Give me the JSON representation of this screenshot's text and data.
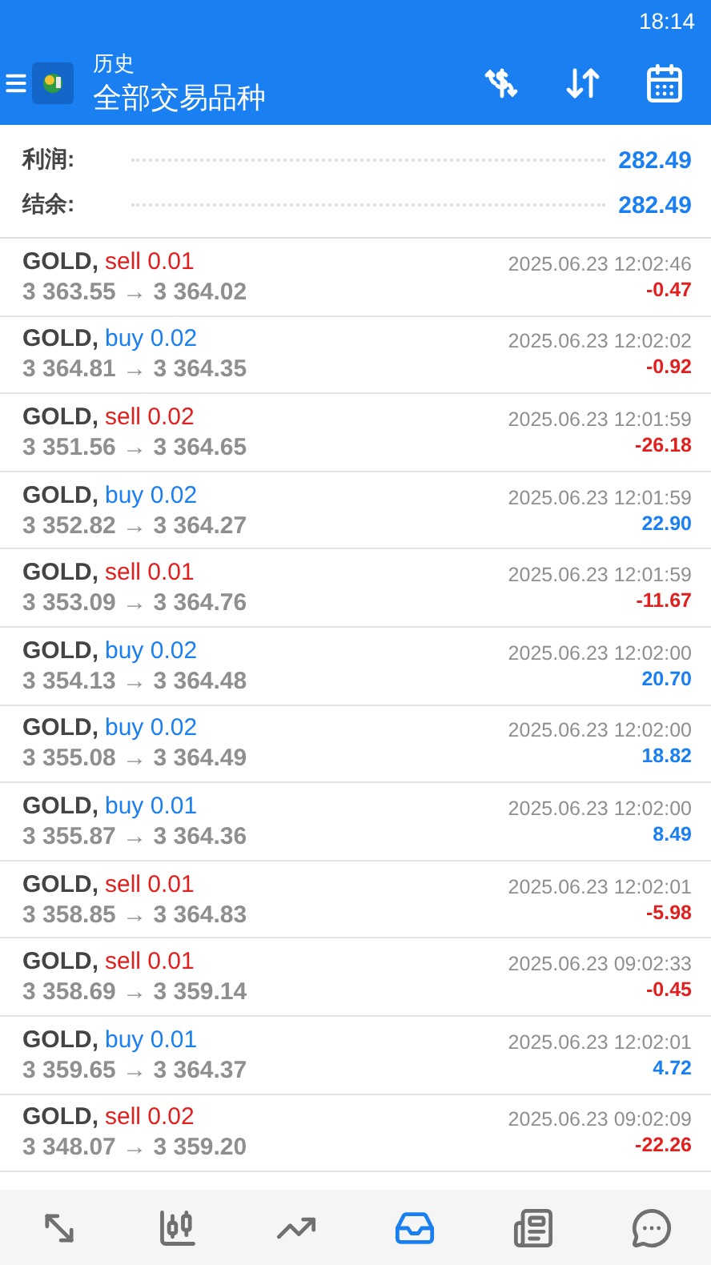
{
  "status_bar": {
    "time": "18:14"
  },
  "header": {
    "title": "历史",
    "subtitle": "全部交易品种"
  },
  "summary": [
    {
      "label": "利润:",
      "value": "282.49"
    },
    {
      "label": "结余:",
      "value": "282.49"
    }
  ],
  "deals": [
    {
      "symbol": "GOLD,",
      "sell": true,
      "order": "sell 0.01",
      "prices": "3 363.55 → 3 364.02",
      "time": "2025.06.23 12:02:46",
      "loss": true,
      "profit": "-0.47"
    },
    {
      "symbol": "GOLD,",
      "sell": false,
      "order": "buy 0.02",
      "prices": "3 364.81 → 3 364.35",
      "time": "2025.06.23 12:02:02",
      "loss": true,
      "profit": "-0.92"
    },
    {
      "symbol": "GOLD,",
      "sell": true,
      "order": "sell 0.02",
      "prices": "3 351.56 → 3 364.65",
      "time": "2025.06.23 12:01:59",
      "loss": true,
      "profit": "-26.18"
    },
    {
      "symbol": "GOLD,",
      "sell": false,
      "order": "buy 0.02",
      "prices": "3 352.82 → 3 364.27",
      "time": "2025.06.23 12:01:59",
      "loss": false,
      "profit": "22.90"
    },
    {
      "symbol": "GOLD,",
      "sell": true,
      "order": "sell 0.01",
      "prices": "3 353.09 → 3 364.76",
      "time": "2025.06.23 12:01:59",
      "loss": true,
      "profit": "-11.67"
    },
    {
      "symbol": "GOLD,",
      "sell": false,
      "order": "buy 0.02",
      "prices": "3 354.13 → 3 364.48",
      "time": "2025.06.23 12:02:00",
      "loss": false,
      "profit": "20.70"
    },
    {
      "symbol": "GOLD,",
      "sell": false,
      "order": "buy 0.02",
      "prices": "3 355.08 → 3 364.49",
      "time": "2025.06.23 12:02:00",
      "loss": false,
      "profit": "18.82"
    },
    {
      "symbol": "GOLD,",
      "sell": false,
      "order": "buy 0.01",
      "prices": "3 355.87 → 3 364.36",
      "time": "2025.06.23 12:02:00",
      "loss": false,
      "profit": "8.49"
    },
    {
      "symbol": "GOLD,",
      "sell": true,
      "order": "sell 0.01",
      "prices": "3 358.85 → 3 364.83",
      "time": "2025.06.23 12:02:01",
      "loss": true,
      "profit": "-5.98"
    },
    {
      "symbol": "GOLD,",
      "sell": true,
      "order": "sell 0.01",
      "prices": "3 358.69 → 3 359.14",
      "time": "2025.06.23 09:02:33",
      "loss": true,
      "profit": "-0.45"
    },
    {
      "symbol": "GOLD,",
      "sell": false,
      "order": "buy 0.01",
      "prices": "3 359.65 → 3 364.37",
      "time": "2025.06.23 12:02:01",
      "loss": false,
      "profit": "4.72"
    },
    {
      "symbol": "GOLD,",
      "sell": true,
      "order": "sell 0.02",
      "prices": "3 348.07 → 3 359.20",
      "time": "2025.06.23 09:02:09",
      "loss": true,
      "profit": "-22.26"
    }
  ],
  "bottom_nav": [
    {
      "kind": "quotes",
      "selected": false
    },
    {
      "kind": "chart",
      "selected": false
    },
    {
      "kind": "trade",
      "selected": false
    },
    {
      "kind": "history",
      "selected": true
    },
    {
      "kind": "news",
      "selected": false
    },
    {
      "kind": "chat",
      "selected": false
    }
  ]
}
